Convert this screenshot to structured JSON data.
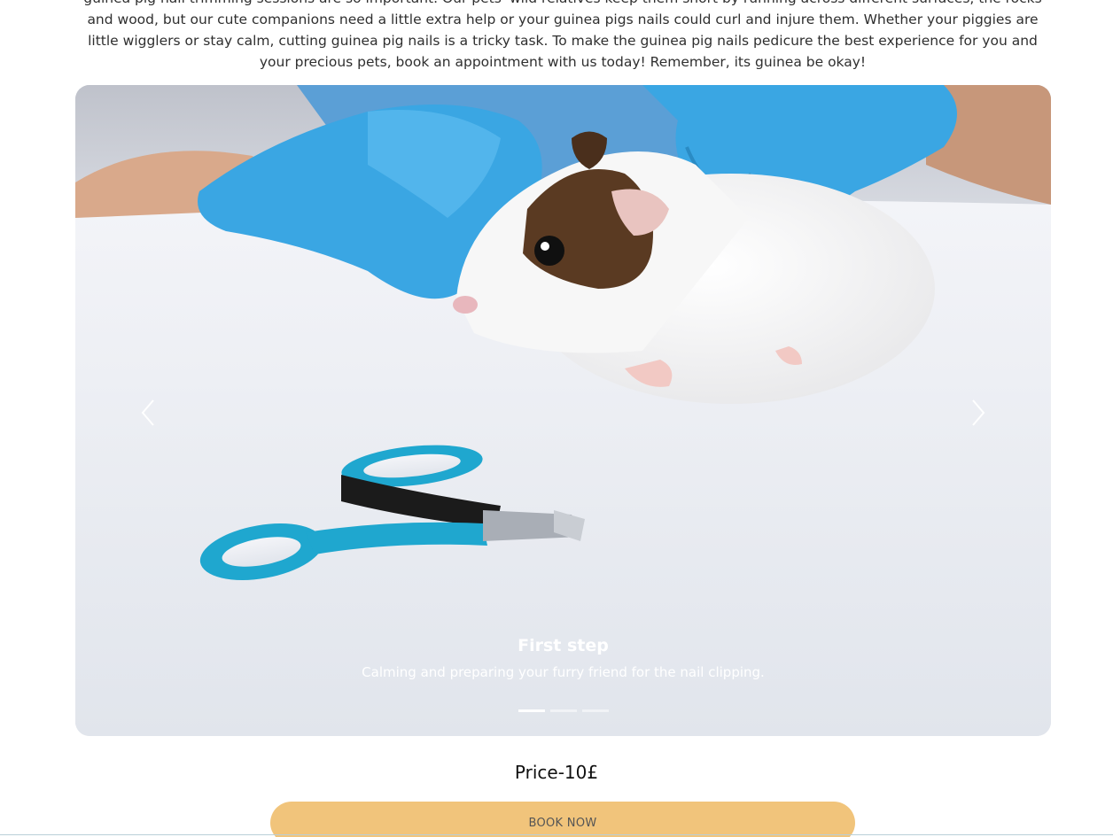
{
  "intro": {
    "text": "guinea pig nail trimming sessions are so important. Our pets' wild relatives keep them short by running across different surfaces, the rocks and wood, but our cute companions need a little extra help or your guinea pigs nails could curl and injure them. Whether your piggies are little wigglers or stay calm, cutting guinea pig nails is a tricky task. To make the guinea pig nails pedicure the best experience for you and your precious pets, book an appointment with us today! Remember, its guinea be okay!"
  },
  "carousel": {
    "slides": [
      {
        "title": "First step",
        "text": "Calming and preparing your furry friend for the nail clipping."
      }
    ],
    "active_index": 0,
    "indicator_count": 3,
    "prev_icon": "chevron-left-icon",
    "next_icon": "chevron-right-icon"
  },
  "pricing": {
    "price_label": "Price-10£"
  },
  "cta": {
    "book_label": "BOOK NOW"
  },
  "colors": {
    "button": "#f1c47b",
    "glove": "#3aa6e3",
    "clipper": "#1fa7cf"
  }
}
